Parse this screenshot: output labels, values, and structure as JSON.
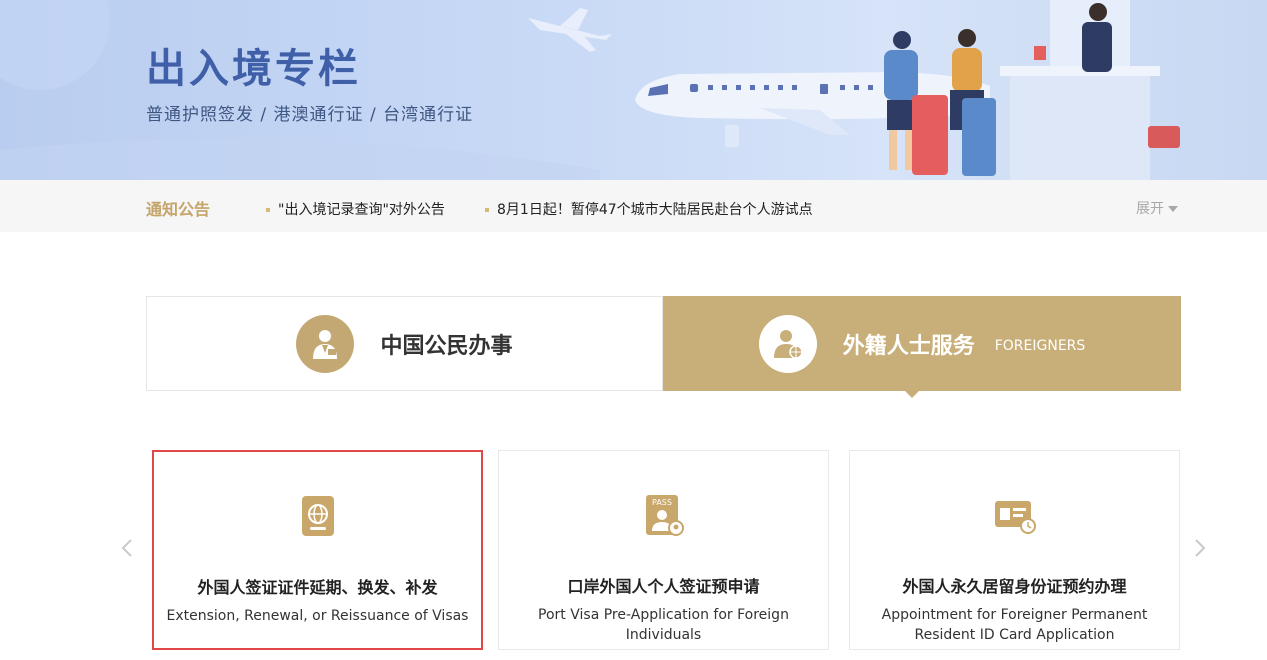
{
  "banner": {
    "title": "出入境专栏",
    "subtitle": "普通护照签发 / 港澳通行证 / 台湾通行证"
  },
  "notice": {
    "title": "通知公告",
    "items": [
      "\"出入境记录查询\"对外公告",
      "8月1日起！暂停47个城市大陆居民赴台个人游试点"
    ],
    "expand_label": "展开"
  },
  "tabs": {
    "citizen": {
      "label": "中国公民办事",
      "icon": "citizen-id-icon"
    },
    "foreigner": {
      "label": "外籍人士服务",
      "label_en": "FOREIGNERS",
      "icon": "foreigner-globe-icon",
      "active": true
    }
  },
  "cards": [
    {
      "title": "外国人签证证件延期、换发、补发",
      "subtitle": "Extension, Renewal, or Reissuance of Visas",
      "icon": "passport-globe-icon",
      "selected": true
    },
    {
      "title": "口岸外国人个人签证预申请",
      "subtitle": "Port Visa Pre-Application for Foreign Individuals",
      "icon": "pass-card-icon"
    },
    {
      "title": "外国人永久居留身份证预约办理",
      "subtitle": "Appointment for Foreigner Permanent Resident ID Card Application",
      "icon": "id-card-clock-icon"
    }
  ],
  "colors": {
    "gold": "#c8ae78",
    "banner_title": "#3f5fa8",
    "selected_border": "#e04848"
  }
}
